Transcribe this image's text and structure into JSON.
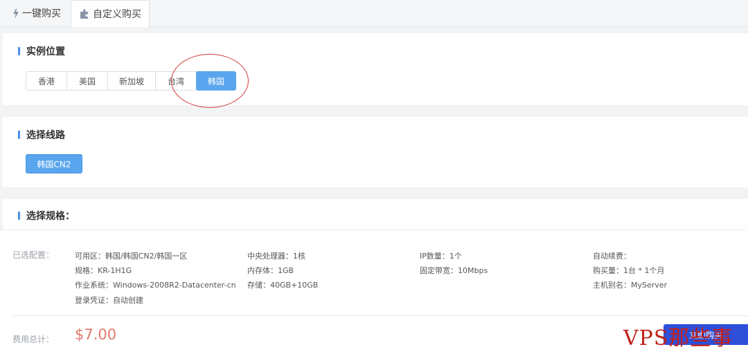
{
  "tabs": [
    {
      "label": "一键购买"
    },
    {
      "label": "自定义购买"
    }
  ],
  "location": {
    "title": "实例位置",
    "options": [
      "香港",
      "美国",
      "新加坡",
      "台湾",
      "韩国"
    ],
    "selected": "韩国"
  },
  "line": {
    "title": "选择线路",
    "options": [
      "韩国CN2"
    ],
    "selected": "韩国CN2"
  },
  "spec": {
    "title": "选择规格："
  },
  "summary": {
    "label": "已选配置：",
    "col1": [
      "可用区：韩国/韩国CN2/韩国一区",
      "规格：KR-1H1G",
      "作业系统：Windows-2008R2-Datacenter-cn",
      "登录凭证：自动创建"
    ],
    "col2": [
      "中央处理器：1核",
      "内存体：1GB",
      "存储：40GB+10GB"
    ],
    "col3": [
      "IP数量：1个",
      "固定带宽：10Mbps"
    ],
    "col4": [
      "自动续费：",
      "购买量：1台 * 1个月",
      "主机别名：MyServer"
    ],
    "fee_label": "费用总计：",
    "fee": "$7.00",
    "buy_label": "立即购买"
  },
  "watermark": "VPS那些事",
  "colors": {
    "accent": "#5aa6ee",
    "buy": "#2f4fd8",
    "fee": "#e07a6e",
    "annotation": "#d23b3b"
  },
  "icons": {
    "tab1": "lightning-bolt-icon",
    "tab2": "puzzle-piece-icon"
  }
}
